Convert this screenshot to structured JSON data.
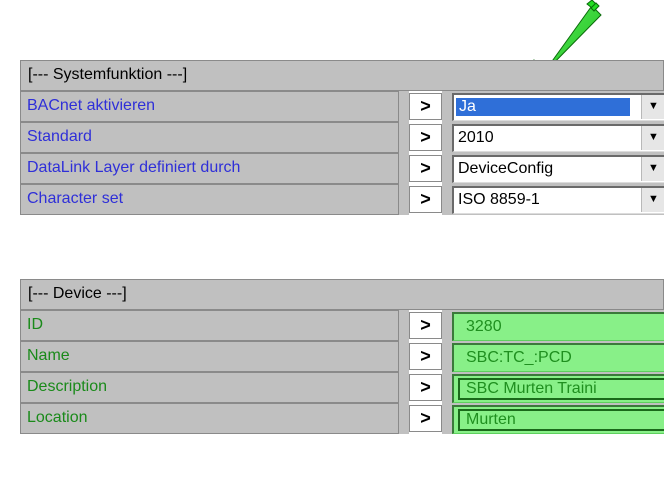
{
  "sections": {
    "system": "[--- Systemfunktion ---]",
    "device": "[--- Device ---]"
  },
  "rows": [
    {
      "label": "BACnet aktivieren",
      "value": "Ja",
      "kind": "select",
      "focused": true
    },
    {
      "label": "Standard",
      "value": "2010",
      "kind": "select"
    },
    {
      "label": "DataLink Layer definiert durch",
      "value": "DeviceConfig",
      "kind": "select"
    },
    {
      "label": "Character set",
      "value": "ISO 8859-1",
      "kind": "select"
    },
    {
      "label": "ID",
      "value": "3280",
      "kind": "input"
    },
    {
      "label": "Name",
      "value": "SBC:TC_:PCD",
      "kind": "input"
    },
    {
      "label": "Description",
      "value": "SBC Murten Traini",
      "kind": "input"
    },
    {
      "label": "Location",
      "value": "Murten",
      "kind": "input"
    }
  ],
  "edit_button_label": ">",
  "dropdown_glyph": "▼",
  "colors": {
    "system_label": "#2f2fd8",
    "device_label": "#1a8a1a",
    "input_bg": "#88f088",
    "callout_arrow": "#22dd22"
  },
  "icons": {
    "callout": "arrow-down-left-icon",
    "dropdown": "chevron-down-icon"
  }
}
